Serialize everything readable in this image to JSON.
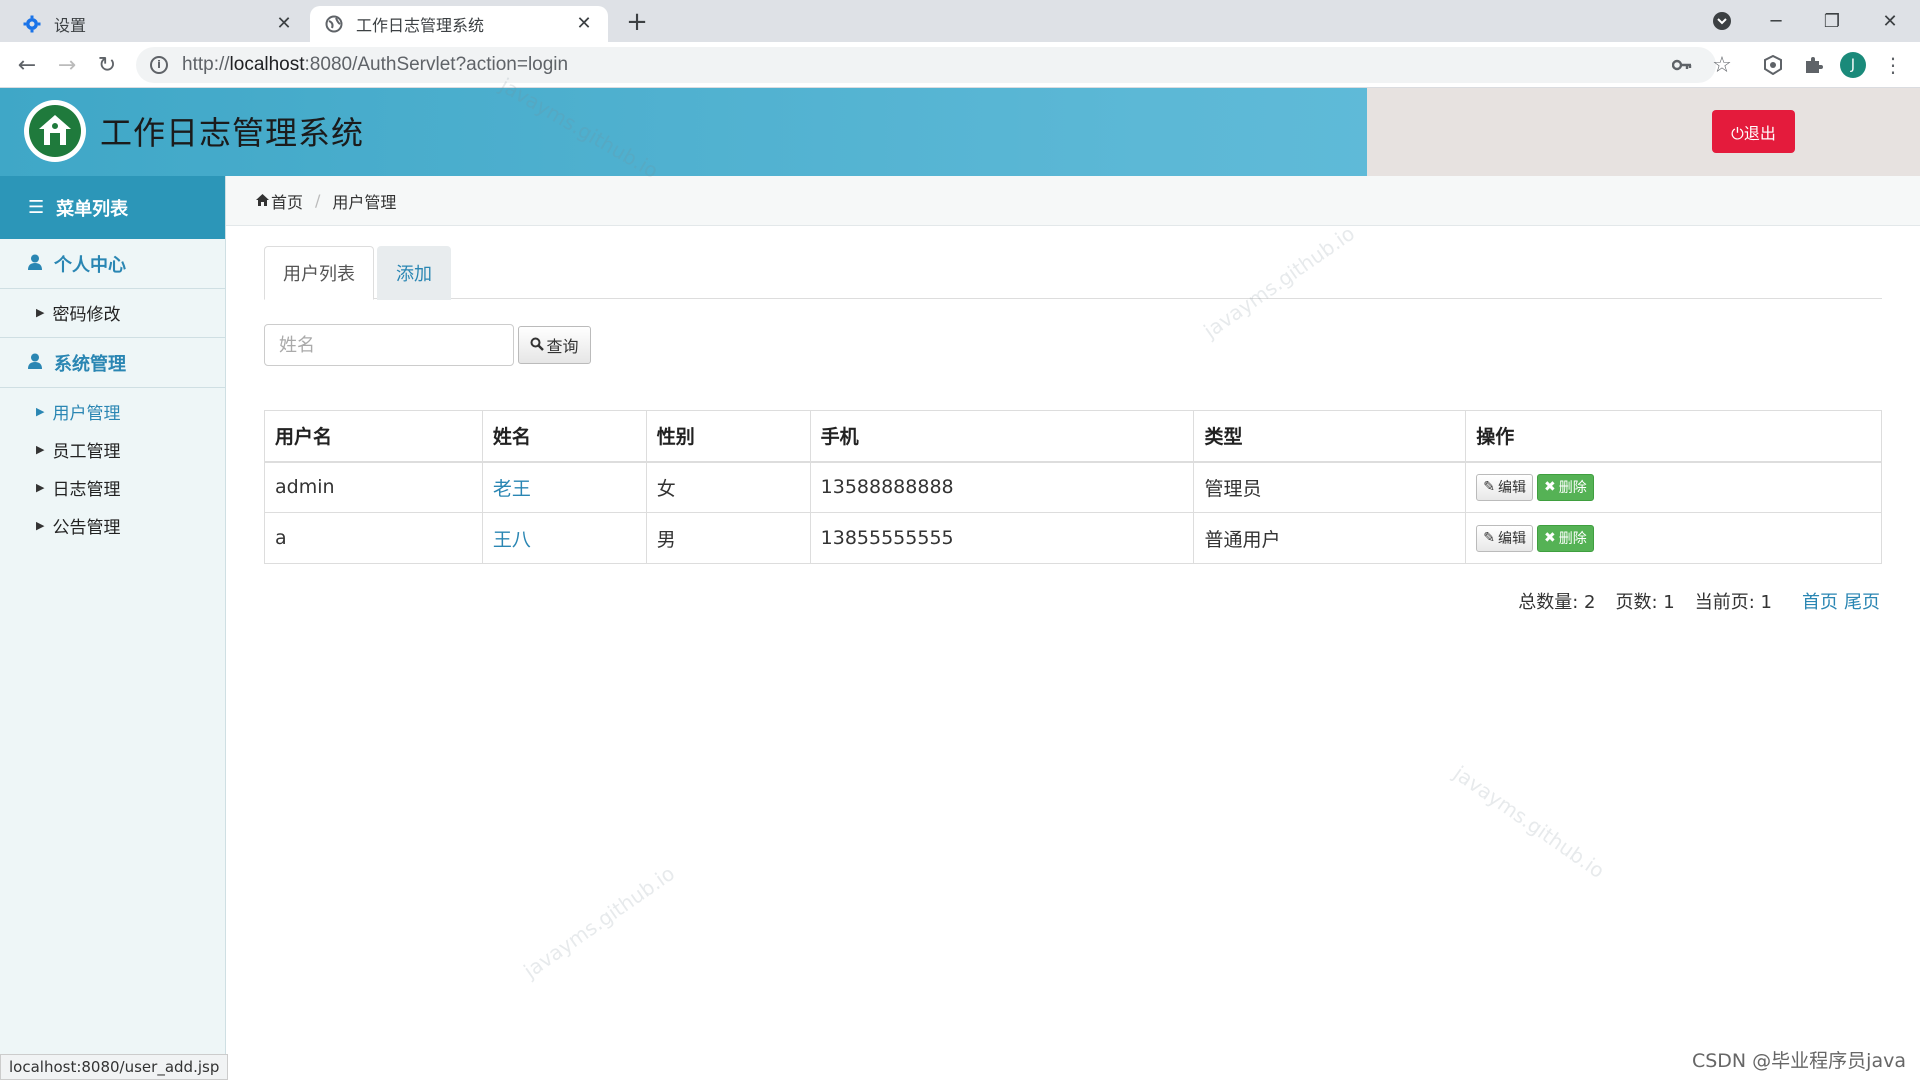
{
  "browser": {
    "tabs": [
      {
        "title": "设置",
        "icon": "gear-icon"
      },
      {
        "title": "工作日志管理系统",
        "icon": "globe-icon"
      }
    ],
    "url_prefix": "http://",
    "url_host": "localhost",
    "url_rest": ":8080/AuthServlet?action=login",
    "profile_initial": "J",
    "status_url": "localhost:8080/user_add.jsp"
  },
  "header": {
    "title": "工作日志管理系统",
    "logout_label": "⏻退出"
  },
  "sidebar": {
    "menu_title": "菜单列表",
    "groups": [
      {
        "label": "个人中心",
        "items": [
          {
            "label": "密码修改"
          }
        ]
      },
      {
        "label": "系统管理",
        "items": [
          {
            "label": "用户管理",
            "active": true
          },
          {
            "label": "员工管理"
          },
          {
            "label": "日志管理"
          },
          {
            "label": "公告管理"
          }
        ]
      }
    ]
  },
  "breadcrumb": {
    "home": "首页",
    "current": "用户管理"
  },
  "tabs": [
    {
      "label": "用户列表",
      "active": true
    },
    {
      "label": "添加"
    }
  ],
  "search": {
    "placeholder": "姓名",
    "button_label": "查询"
  },
  "table": {
    "columns": [
      "用户名",
      "姓名",
      "性别",
      "手机",
      "类型",
      "操作"
    ],
    "rows": [
      {
        "username": "admin",
        "name": "老王",
        "gender": "女",
        "phone": "13588888888",
        "type": "管理员"
      },
      {
        "username": "a",
        "name": "王八",
        "gender": "男",
        "phone": "13855555555",
        "type": "普通用户"
      }
    ],
    "edit_label": "编辑",
    "delete_label": "删除"
  },
  "pager": {
    "total_label": "总数量: 2",
    "pages_label": "页数: 1",
    "current_label": "当前页: 1",
    "first_label": "首页",
    "last_label": "尾页"
  },
  "watermark": "javayms.github.io",
  "footer_credit": "CSDN @毕业程序员java"
}
